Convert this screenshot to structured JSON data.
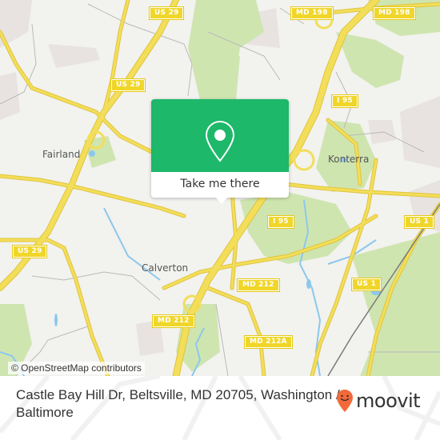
{
  "map": {
    "colors": {
      "background": "#f2f2ef",
      "park": "#cfe5b0",
      "residential": "#e8e3e0",
      "road": "#f3de5a",
      "road_casing": "#e0c43c",
      "water": "#8cc8ec",
      "minor_road": "#b8b8b8"
    },
    "place_labels": [
      {
        "id": "fairland",
        "text": "Fairland"
      },
      {
        "id": "konterra",
        "text": "Konterra"
      },
      {
        "id": "calverton",
        "text": "Calverton"
      }
    ],
    "road_shields": [
      {
        "id": "us29-top",
        "text": "US 29"
      },
      {
        "id": "us29-mid",
        "text": "US 29"
      },
      {
        "id": "us29-left",
        "text": "US 29"
      },
      {
        "id": "md198-a",
        "text": "MD 198"
      },
      {
        "id": "md198-b",
        "text": "MD 198"
      },
      {
        "id": "i95-top",
        "text": "I 95"
      },
      {
        "id": "i95-mid",
        "text": "I 95"
      },
      {
        "id": "us1-top",
        "text": "US 1"
      },
      {
        "id": "us1-mid",
        "text": "US 1"
      },
      {
        "id": "md212-a",
        "text": "MD 212"
      },
      {
        "id": "md212-b",
        "text": "MD 212"
      },
      {
        "id": "md212a",
        "text": "MD 212A"
      }
    ],
    "attribution": "© OpenStreetMap contributors"
  },
  "popup": {
    "icon": "location-pin-icon",
    "button_label": "Take me there",
    "accent_color": "#1db86a"
  },
  "footer": {
    "address": "Castle Bay Hill Dr, Beltsville, MD 20705, Washington / Baltimore",
    "brand": {
      "name": "moovit",
      "icon": "moovit-smiley-pin-icon",
      "color": "#f26a3a"
    }
  }
}
